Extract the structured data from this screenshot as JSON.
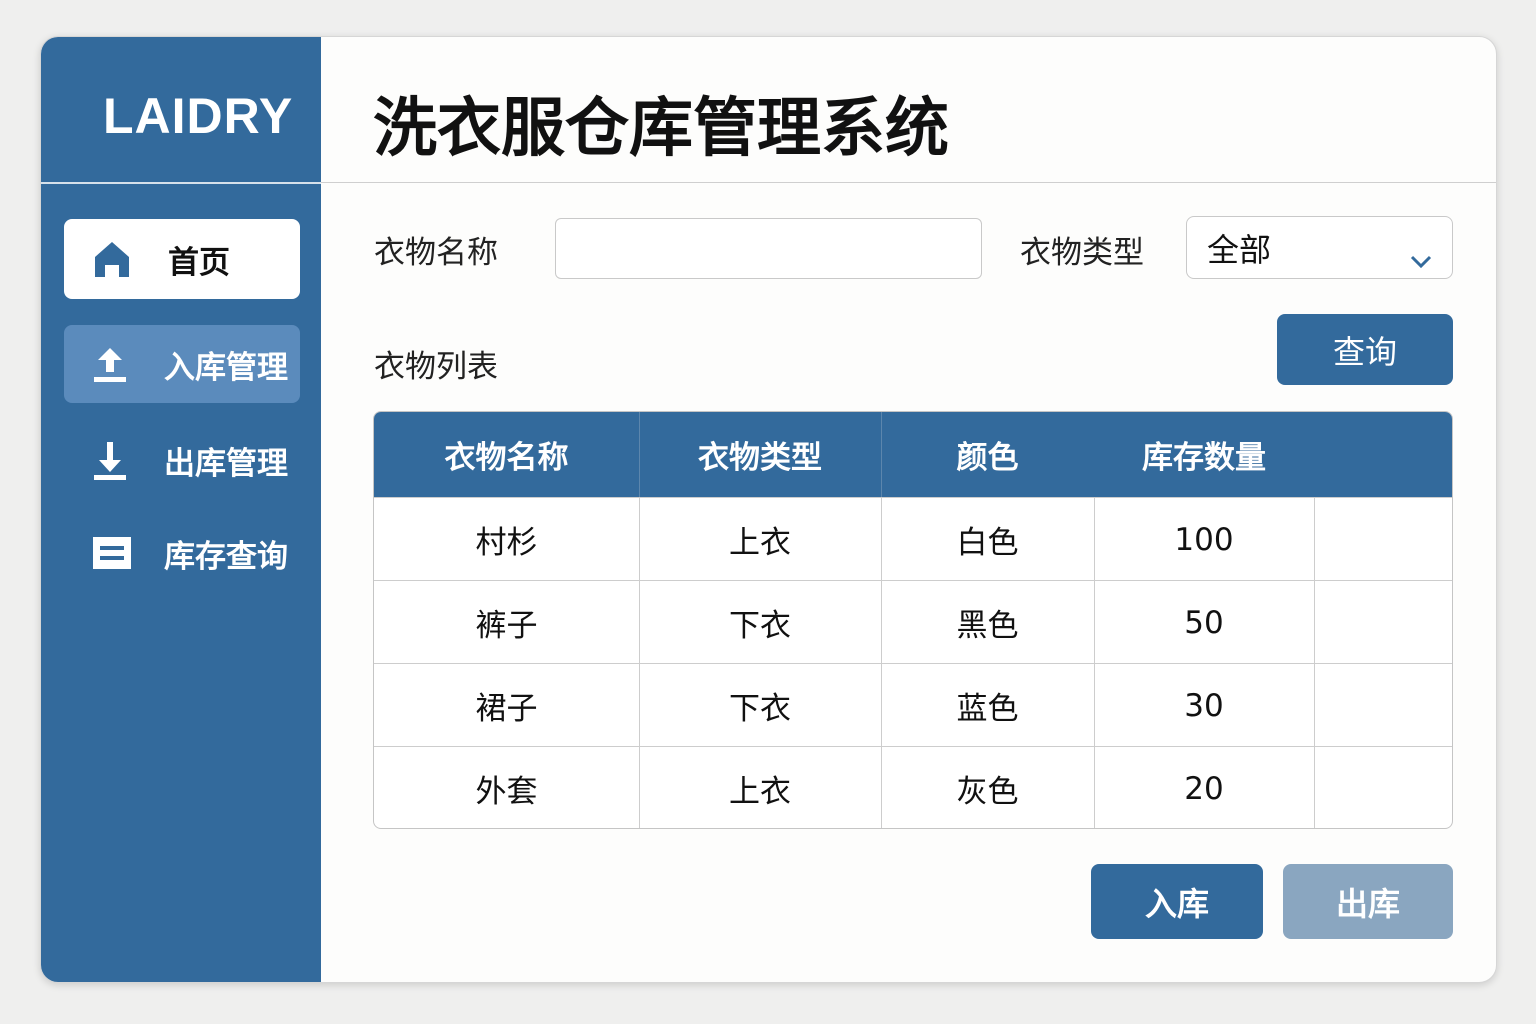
{
  "logo": "LAIDRY",
  "title": "洗衣服仓库管理系统",
  "sidebar": {
    "items": [
      {
        "label": "首页",
        "icon": "home-icon"
      },
      {
        "label": "入库管理",
        "icon": "upload-icon"
      },
      {
        "label": "出库管理",
        "icon": "download-icon"
      },
      {
        "label": "库存查询",
        "icon": "list-icon"
      }
    ]
  },
  "filters": {
    "name_label": "衣物名称",
    "name_value": "",
    "type_label": "衣物类型",
    "type_value": "全部"
  },
  "list_title": "衣物列表",
  "buttons": {
    "query": "查询",
    "stock_in": "入库",
    "stock_out": "出库"
  },
  "table": {
    "headers": [
      "衣物名称",
      "衣物类型",
      "颜色",
      "库存数量"
    ],
    "rows": [
      [
        "村杉",
        "上衣",
        "白色",
        "100"
      ],
      [
        "裤子",
        "下衣",
        "黑色",
        "50"
      ],
      [
        "裙子",
        "下衣",
        "蓝色",
        "30"
      ],
      [
        "外套",
        "上衣",
        "灰色",
        "20"
      ]
    ]
  },
  "colors": {
    "primary": "#336a9c",
    "disabled": "#8aa6c0"
  }
}
